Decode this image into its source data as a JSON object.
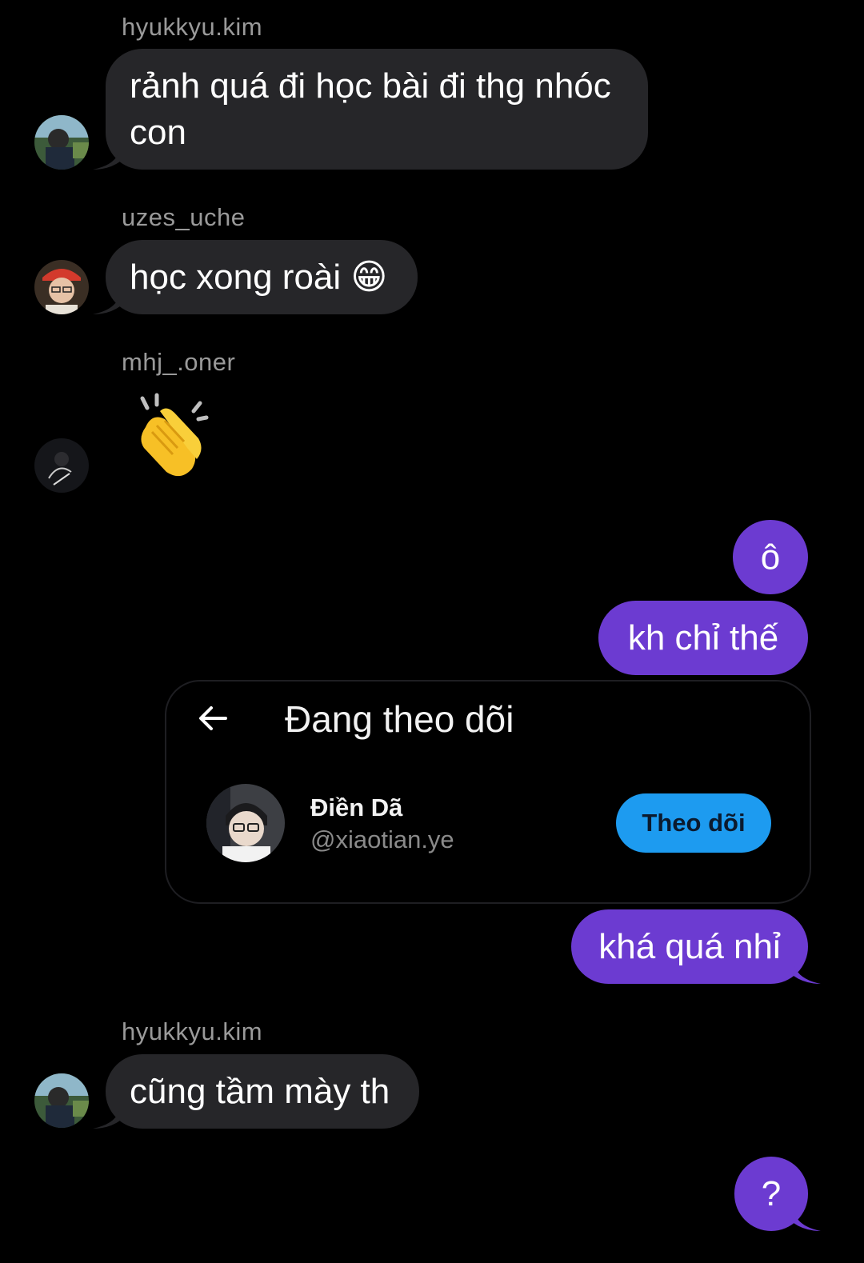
{
  "messages": {
    "m1": {
      "sender": "hyukkyu.kim",
      "text": "rảnh quá đi học bài đi thg nhóc con"
    },
    "m2": {
      "sender": "uzes_uche",
      "text": "học xong roài 😁"
    },
    "m3": {
      "sender": "mhj_.oner",
      "emoji": "clapping-hands"
    },
    "m4": {
      "text": "ô"
    },
    "m5": {
      "text": "kh chỉ thế"
    },
    "m6": {
      "text": "khá quá nhỉ"
    },
    "m7": {
      "sender": "hyukkyu.kim",
      "text": "cũng tầm mày th"
    },
    "m8": {
      "text": "?"
    }
  },
  "shared_card": {
    "title": "Đang theo dõi",
    "user_name": "Điền Dã",
    "user_handle": "@xiaotian.ye",
    "follow_label": "Theo dõi"
  },
  "colors": {
    "incoming_bubble": "#262629",
    "outgoing_bubble": "#6c3bd1",
    "follow_button": "#1d9bf0",
    "sender_name": "#9a9a9a"
  }
}
